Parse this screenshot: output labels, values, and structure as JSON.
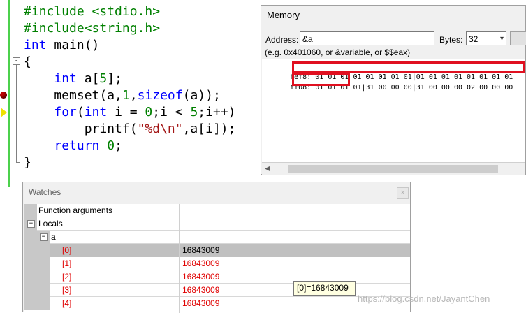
{
  "editor": {
    "lines": [
      [
        {
          "t": "#include <stdio.h>",
          "c": "pp"
        }
      ],
      [
        {
          "t": "#include<string.h>",
          "c": "pp"
        }
      ],
      [
        {
          "t": "int",
          "c": "kw"
        },
        {
          "t": " main()",
          "c": ""
        }
      ],
      [
        {
          "t": "{",
          "c": ""
        }
      ],
      [
        {
          "t": "    ",
          "c": ""
        },
        {
          "t": "int",
          "c": "kw"
        },
        {
          "t": " a[",
          "c": ""
        },
        {
          "t": "5",
          "c": "num"
        },
        {
          "t": "];",
          "c": ""
        }
      ],
      [
        {
          "t": "    memset(a,",
          "c": ""
        },
        {
          "t": "1",
          "c": "num"
        },
        {
          "t": ",",
          "c": ""
        },
        {
          "t": "sizeof",
          "c": "kw"
        },
        {
          "t": "(a));",
          "c": ""
        }
      ],
      [
        {
          "t": "    ",
          "c": ""
        },
        {
          "t": "for",
          "c": "kw"
        },
        {
          "t": "(",
          "c": ""
        },
        {
          "t": "int",
          "c": "kw"
        },
        {
          "t": " i = ",
          "c": ""
        },
        {
          "t": "0",
          "c": "num"
        },
        {
          "t": ";i < ",
          "c": ""
        },
        {
          "t": "5",
          "c": "num"
        },
        {
          "t": ";i++)",
          "c": ""
        }
      ],
      [
        {
          "t": "        printf(",
          "c": ""
        },
        {
          "t": "\"%d\\n\"",
          "c": "str"
        },
        {
          "t": ",a[i]);",
          "c": ""
        }
      ],
      [
        {
          "t": "    ",
          "c": ""
        },
        {
          "t": "return",
          "c": "kw"
        },
        {
          "t": " ",
          "c": ""
        },
        {
          "t": "0",
          "c": "num"
        },
        {
          "t": ";",
          "c": ""
        }
      ],
      [
        {
          "t": "}",
          "c": ""
        }
      ]
    ],
    "fold_symbol": "-"
  },
  "memory": {
    "title": "Memory",
    "address_label": "Address:",
    "address_value": "&a",
    "bytes_label": "Bytes:",
    "bytes_value": "32",
    "hint": "(e.g. 0x401060, or &variable, or $$eax)",
    "rows": [
      {
        "addr": "fef8:",
        "bytes": "01 01 01 01 01 01 01 01|01 01 01 01 01 01 01 01"
      },
      {
        "addr": "ff08:",
        "bytes": "01 01 01 01|31 00 00 00|31 00 00 00 02 00 00 00"
      }
    ]
  },
  "watches": {
    "title": "Watches",
    "close_glyph": "×",
    "expander_glyph": "−",
    "rows": [
      {
        "name": "Function arguments",
        "value": "",
        "level": 0,
        "red": false,
        "expander": false
      },
      {
        "name": "Locals",
        "value": "",
        "level": 0,
        "red": false,
        "expander": true
      },
      {
        "name": "a",
        "value": "",
        "level": 1,
        "red": false,
        "expander": true
      },
      {
        "name": "[0]",
        "value": "16843009",
        "level": 2,
        "red": true,
        "expander": false,
        "selected": true
      },
      {
        "name": "[1]",
        "value": "16843009",
        "level": 2,
        "red": true,
        "expander": false
      },
      {
        "name": "[2]",
        "value": "16843009",
        "level": 2,
        "red": true,
        "expander": false
      },
      {
        "name": "[3]",
        "value": "16843009",
        "level": 2,
        "red": true,
        "expander": false
      },
      {
        "name": "[4]",
        "value": "16843009",
        "level": 2,
        "red": true,
        "expander": false
      }
    ]
  },
  "tooltip": "[0]=16843009",
  "watermark": "https://blog.csdn.net/JayantChen",
  "colors": {
    "preprocessor": "#008000",
    "keyword": "#0000ff",
    "highlight_box": "#e01020",
    "watch_changed": "#e00000"
  }
}
